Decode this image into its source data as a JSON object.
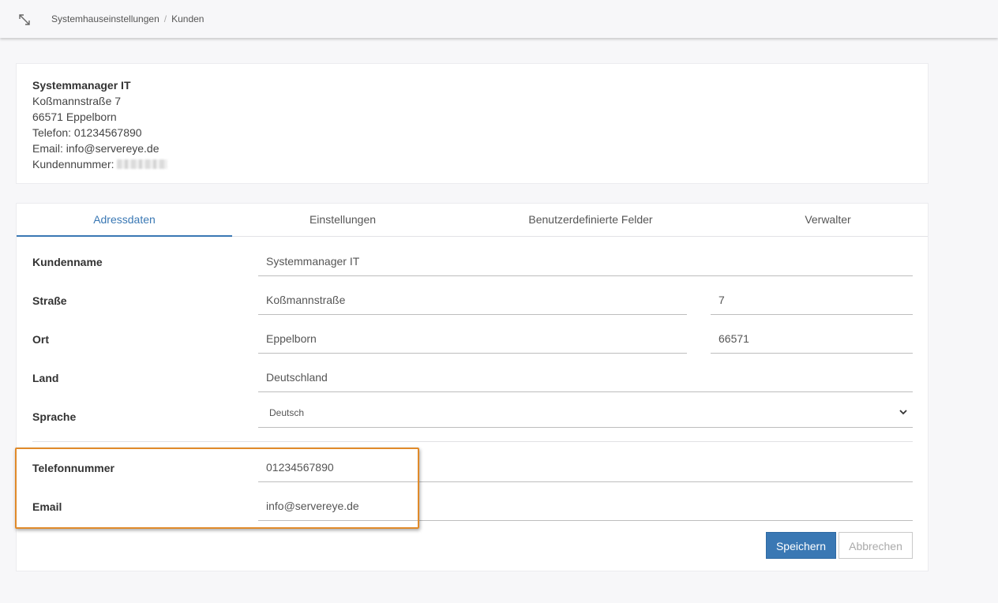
{
  "breadcrumb": {
    "parent": "Systemhauseinstellungen",
    "separator": "/",
    "current": "Kunden"
  },
  "info": {
    "name": "Systemmanager IT",
    "street": "Koßmannstraße 7",
    "city": "66571 Eppelborn",
    "phone": "Telefon: 01234567890",
    "email": "Email: info@servereye.de",
    "customer_number_label": "Kundennummer:"
  },
  "tabs": [
    {
      "label": "Adressdaten",
      "active": true
    },
    {
      "label": "Einstellungen",
      "active": false
    },
    {
      "label": "Benutzerdefinierte Felder",
      "active": false
    },
    {
      "label": "Verwalter",
      "active": false
    }
  ],
  "form": {
    "customer_name": {
      "label": "Kundenname",
      "value": "Systemmanager IT"
    },
    "street": {
      "label": "Straße",
      "value": "Koßmannstraße",
      "number": "7"
    },
    "city": {
      "label": "Ort",
      "value": "Eppelborn",
      "zip": "66571"
    },
    "country": {
      "label": "Land",
      "value": "Deutschland"
    },
    "language": {
      "label": "Sprache",
      "value": "Deutsch"
    },
    "phone": {
      "label": "Telefonnummer",
      "value": "01234567890"
    },
    "email": {
      "label": "Email",
      "value": "info@servereye.de"
    }
  },
  "buttons": {
    "save": "Speichern",
    "cancel": "Abbrechen"
  },
  "colors": {
    "accent": "#3a78b4",
    "highlight": "#e08a2a"
  },
  "icons": {
    "expand": "expand-icon",
    "select": "chevron-down-icon"
  }
}
